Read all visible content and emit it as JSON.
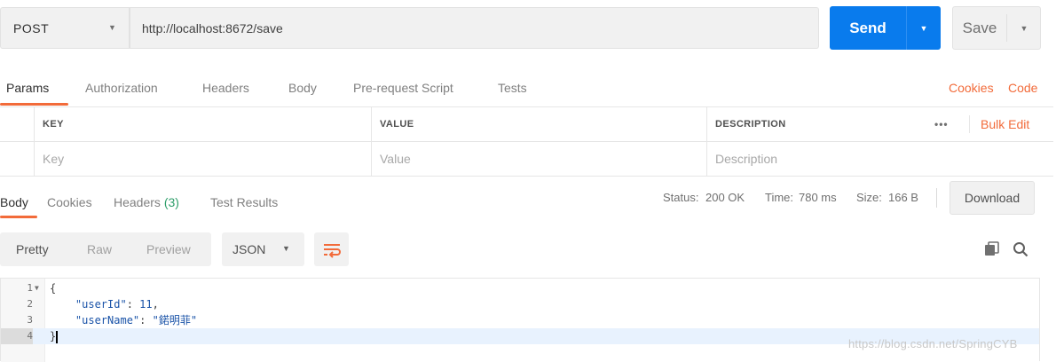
{
  "request": {
    "method": "POST",
    "url": "http://localhost:8672/save",
    "send_label": "Send",
    "save_label": "Save"
  },
  "request_tabs": [
    "Params",
    "Authorization",
    "Headers",
    "Body",
    "Pre-request Script",
    "Tests"
  ],
  "request_links": {
    "cookies": "Cookies",
    "code": "Code"
  },
  "params_table": {
    "headers": [
      "KEY",
      "VALUE",
      "DESCRIPTION"
    ],
    "more": "•••",
    "bulk_edit": "Bulk Edit",
    "placeholders": {
      "key": "Key",
      "value": "Value",
      "description": "Description"
    }
  },
  "response_tabs": {
    "body": "Body",
    "cookies": "Cookies",
    "headers": "Headers",
    "headers_count": "(3)",
    "test_results": "Test Results"
  },
  "status": {
    "status_label": "Status:",
    "status_value": "200 OK",
    "time_label": "Time:",
    "time_value": "780 ms",
    "size_label": "Size:",
    "size_value": "166 B"
  },
  "download_label": "Download",
  "view": {
    "modes": [
      "Pretty",
      "Raw",
      "Preview"
    ],
    "active_mode": "Pretty",
    "format": "JSON"
  },
  "response_body": {
    "line_numbers": [
      "1",
      "2",
      "3",
      "4"
    ],
    "open_brace": "{",
    "close_brace": "}",
    "user_id_key": "\"userId\"",
    "user_id_value": "11",
    "user_name_key": "\"userName\"",
    "user_name_value": "\"鍩明菲\""
  },
  "watermark": "https://blog.csdn.net/SpringCYB",
  "colors": {
    "accent_orange": "#f26b3a",
    "send_blue": "#097bed",
    "status_green": "#2e9e6a"
  },
  "icons": [
    "chevron-down-icon",
    "wrap-lines-icon",
    "copy-icon",
    "search-icon",
    "fold-arrow-icon"
  ]
}
